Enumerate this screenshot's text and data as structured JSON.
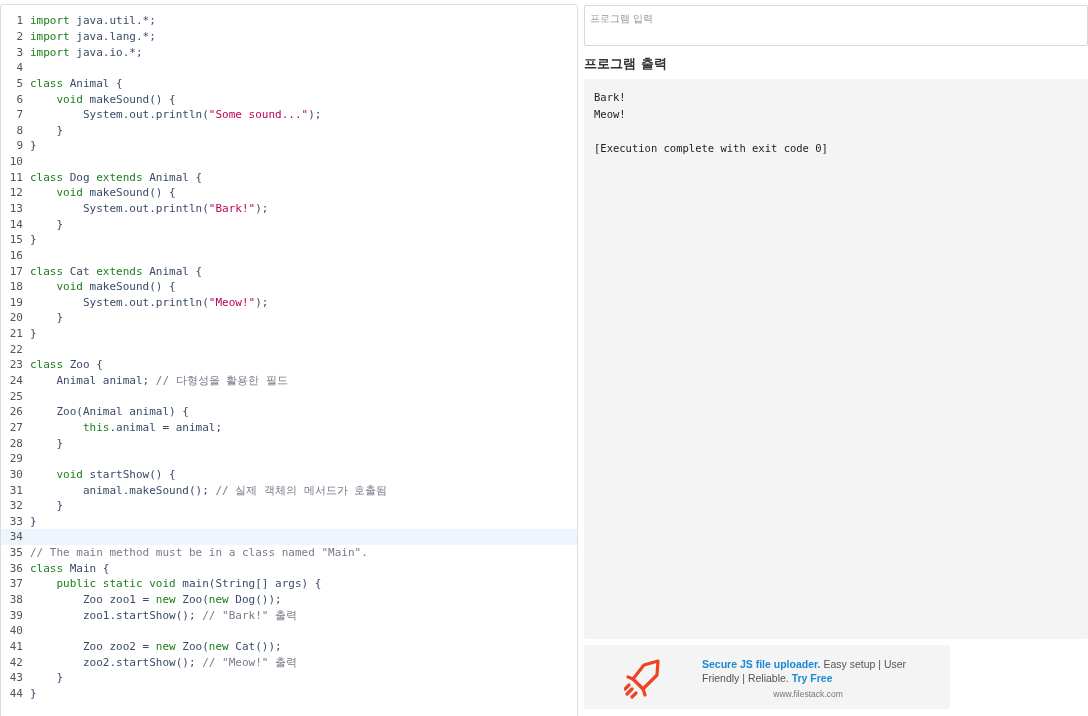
{
  "editor": {
    "lines": [
      {
        "number": "1",
        "current": false,
        "tokens": [
          {
            "kind": "keyword",
            "text": "import"
          },
          {
            "kind": "plain",
            "text": " java.util.*;"
          }
        ]
      },
      {
        "number": "2",
        "current": false,
        "tokens": [
          {
            "kind": "keyword",
            "text": "import"
          },
          {
            "kind": "plain",
            "text": " java.lang.*;"
          }
        ]
      },
      {
        "number": "3",
        "current": false,
        "tokens": [
          {
            "kind": "keyword",
            "text": "import"
          },
          {
            "kind": "plain",
            "text": " java.io.*;"
          }
        ]
      },
      {
        "number": "4",
        "current": false
      },
      {
        "number": "5",
        "current": false,
        "tokens": [
          {
            "kind": "keyword",
            "text": "class"
          },
          {
            "kind": "plain",
            "text": " Animal {"
          }
        ]
      },
      {
        "number": "6",
        "current": false,
        "tokens": [
          {
            "kind": "keyword",
            "text": "    void"
          },
          {
            "kind": "plain",
            "text": " makeSound() {"
          }
        ]
      },
      {
        "number": "7",
        "current": false,
        "tokens": [
          {
            "kind": "plain",
            "text": "        System.out.println("
          },
          {
            "kind": "string",
            "text": "\"Some sound...\""
          },
          {
            "kind": "plain",
            "text": ");"
          }
        ]
      },
      {
        "number": "8",
        "current": false,
        "tokens": [
          {
            "kind": "plain",
            "text": "    }"
          }
        ]
      },
      {
        "number": "9",
        "current": false,
        "tokens": [
          {
            "kind": "plain",
            "text": "}"
          }
        ]
      },
      {
        "number": "10",
        "current": false
      },
      {
        "number": "11",
        "current": false,
        "tokens": [
          {
            "kind": "keyword",
            "text": "class"
          },
          {
            "kind": "plain",
            "text": " Dog "
          },
          {
            "kind": "keyword",
            "text": "extends"
          },
          {
            "kind": "plain",
            "text": " Animal {"
          }
        ]
      },
      {
        "number": "12",
        "current": false,
        "tokens": [
          {
            "kind": "keyword",
            "text": "    void"
          },
          {
            "kind": "plain",
            "text": " makeSound() {"
          }
        ]
      },
      {
        "number": "13",
        "current": false,
        "tokens": [
          {
            "kind": "plain",
            "text": "        System.out.println("
          },
          {
            "kind": "string",
            "text": "\"Bark!\""
          },
          {
            "kind": "plain",
            "text": ");"
          }
        ]
      },
      {
        "number": "14",
        "current": false,
        "tokens": [
          {
            "kind": "plain",
            "text": "    }"
          }
        ]
      },
      {
        "number": "15",
        "current": false,
        "tokens": [
          {
            "kind": "plain",
            "text": "}"
          }
        ]
      },
      {
        "number": "16",
        "current": false
      },
      {
        "number": "17",
        "current": false,
        "tokens": [
          {
            "kind": "keyword",
            "text": "class"
          },
          {
            "kind": "plain",
            "text": " Cat "
          },
          {
            "kind": "keyword",
            "text": "extends"
          },
          {
            "kind": "plain",
            "text": " Animal {"
          }
        ]
      },
      {
        "number": "18",
        "current": false,
        "tokens": [
          {
            "kind": "keyword",
            "text": "    void"
          },
          {
            "kind": "plain",
            "text": " makeSound() {"
          }
        ]
      },
      {
        "number": "19",
        "current": false,
        "tokens": [
          {
            "kind": "plain",
            "text": "        System.out.println("
          },
          {
            "kind": "string",
            "text": "\"Meow!\""
          },
          {
            "kind": "plain",
            "text": ");"
          }
        ]
      },
      {
        "number": "20",
        "current": false,
        "tokens": [
          {
            "kind": "plain",
            "text": "    }"
          }
        ]
      },
      {
        "number": "21",
        "current": false,
        "tokens": [
          {
            "kind": "plain",
            "text": "}"
          }
        ]
      },
      {
        "number": "22",
        "current": false
      },
      {
        "number": "23",
        "current": false,
        "tokens": [
          {
            "kind": "keyword",
            "text": "class"
          },
          {
            "kind": "plain",
            "text": " Zoo {"
          }
        ]
      },
      {
        "number": "24",
        "current": false,
        "tokens": [
          {
            "kind": "plain",
            "text": "    Animal animal; "
          },
          {
            "kind": "comment",
            "text": "// 다형성을 활용한 필드"
          }
        ]
      },
      {
        "number": "25",
        "current": false
      },
      {
        "number": "26",
        "current": false,
        "tokens": [
          {
            "kind": "plain",
            "text": "    Zoo(Animal animal) {"
          }
        ]
      },
      {
        "number": "27",
        "current": false,
        "tokens": [
          {
            "kind": "keyword",
            "text": "        this"
          },
          {
            "kind": "plain",
            "text": ".animal = animal;"
          }
        ]
      },
      {
        "number": "28",
        "current": false,
        "tokens": [
          {
            "kind": "plain",
            "text": "    }"
          }
        ]
      },
      {
        "number": "29",
        "current": false
      },
      {
        "number": "30",
        "current": false,
        "tokens": [
          {
            "kind": "keyword",
            "text": "    void"
          },
          {
            "kind": "plain",
            "text": " startShow() {"
          }
        ]
      },
      {
        "number": "31",
        "current": false,
        "tokens": [
          {
            "kind": "plain",
            "text": "        animal.makeSound(); "
          },
          {
            "kind": "comment",
            "text": "// 실제 객체의 메서드가 호출됨"
          }
        ]
      },
      {
        "number": "32",
        "current": false,
        "tokens": [
          {
            "kind": "plain",
            "text": "    }"
          }
        ]
      },
      {
        "number": "33",
        "current": false,
        "tokens": [
          {
            "kind": "plain",
            "text": "}"
          }
        ]
      },
      {
        "number": "34",
        "current": true
      },
      {
        "number": "35",
        "current": false,
        "tokens": [
          {
            "kind": "comment",
            "text": "// The main method must be in a class named \"Main\"."
          }
        ]
      },
      {
        "number": "36",
        "current": false,
        "tokens": [
          {
            "kind": "keyword",
            "text": "class"
          },
          {
            "kind": "plain",
            "text": " Main {"
          }
        ]
      },
      {
        "number": "37",
        "current": false,
        "tokens": [
          {
            "kind": "keyword",
            "text": "    public static void"
          },
          {
            "kind": "plain",
            "text": " main(String[] args) {"
          }
        ]
      },
      {
        "number": "38",
        "current": false,
        "tokens": [
          {
            "kind": "plain",
            "text": "        Zoo zoo1 = "
          },
          {
            "kind": "keyword",
            "text": "new"
          },
          {
            "kind": "plain",
            "text": " Zoo("
          },
          {
            "kind": "keyword",
            "text": "new"
          },
          {
            "kind": "plain",
            "text": " Dog());"
          }
        ]
      },
      {
        "number": "39",
        "current": false,
        "tokens": [
          {
            "kind": "plain",
            "text": "        zoo1.startShow(); "
          },
          {
            "kind": "comment",
            "text": "// \"Bark!\" 출력"
          }
        ]
      },
      {
        "number": "40",
        "current": false
      },
      {
        "number": "41",
        "current": false,
        "tokens": [
          {
            "kind": "plain",
            "text": "        Zoo zoo2 = "
          },
          {
            "kind": "keyword",
            "text": "new"
          },
          {
            "kind": "plain",
            "text": " Zoo("
          },
          {
            "kind": "keyword",
            "text": "new"
          },
          {
            "kind": "plain",
            "text": " Cat());"
          }
        ]
      },
      {
        "number": "42",
        "current": false,
        "tokens": [
          {
            "kind": "plain",
            "text": "        zoo2.startShow(); "
          },
          {
            "kind": "comment",
            "text": "// \"Meow!\" 출력"
          }
        ]
      },
      {
        "number": "43",
        "current": false,
        "tokens": [
          {
            "kind": "plain",
            "text": "    }"
          }
        ]
      },
      {
        "number": "44",
        "current": false,
        "tokens": [
          {
            "kind": "plain",
            "text": "}"
          }
        ]
      }
    ]
  },
  "input": {
    "placeholder": "프로그램 입력"
  },
  "output": {
    "heading": "프로그램 출력",
    "lines": [
      "Bark!",
      "Meow!"
    ],
    "status": "[Execution complete with exit code 0]"
  },
  "ad": {
    "text": "**Secure JS file uploader.** Easy setup | User Friendly | Reliable. **Try Free**",
    "url": "www.filestack.com"
  }
}
